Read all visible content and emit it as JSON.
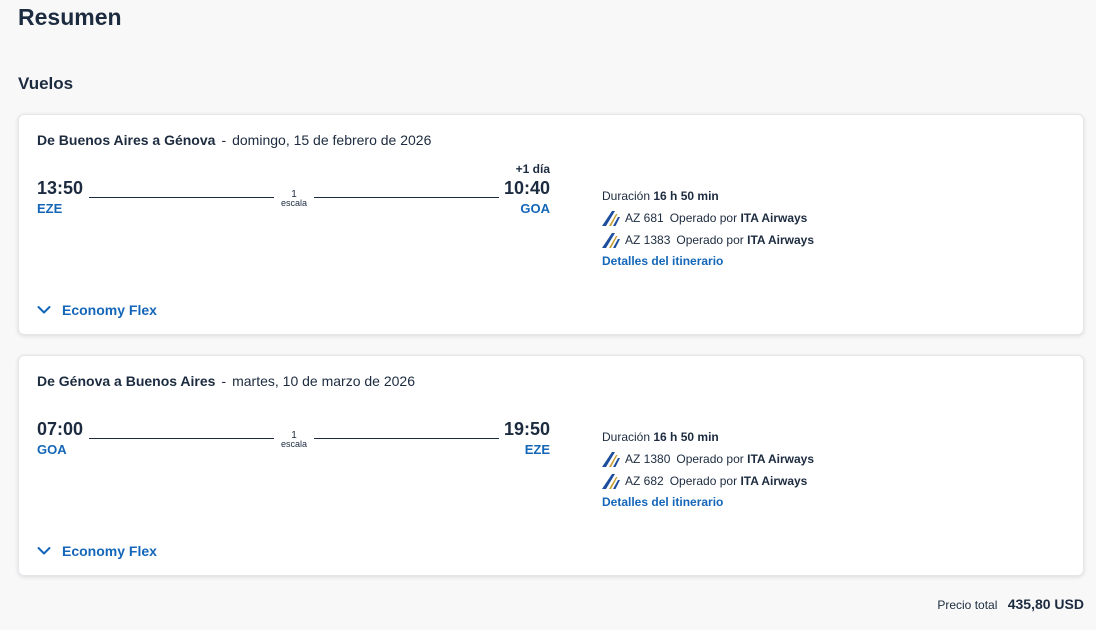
{
  "page": {
    "title": "Resumen",
    "section_title": "Vuelos"
  },
  "flights": [
    {
      "route": "De Buenos Aires a Génova",
      "separator": "-",
      "date": "domingo, 15 de febrero de 2026",
      "departure_time": "13:50",
      "departure_airport": "EZE",
      "arrival_time": "10:40",
      "arrival_airport": "GOA",
      "day_offset": "+1 día",
      "stops_count": "1",
      "stops_label": "escala",
      "duration_label": "Duración",
      "duration_value": "16 h 50 min",
      "segments": [
        {
          "flight_number": "AZ 681",
          "operated_by_label": "Operado por",
          "operator": "ITA Airways"
        },
        {
          "flight_number": "AZ 1383",
          "operated_by_label": "Operado por",
          "operator": "ITA Airways"
        }
      ],
      "itinerary_link": "Detalles del itinerario",
      "fare_name": "Economy Flex"
    },
    {
      "route": "De Génova a Buenos Aires",
      "separator": "-",
      "date": "martes, 10 de marzo de 2026",
      "departure_time": "07:00",
      "departure_airport": "GOA",
      "arrival_time": "19:50",
      "arrival_airport": "EZE",
      "stops_count": "1",
      "stops_label": "escala",
      "duration_label": "Duración",
      "duration_value": "16 h 50 min",
      "segments": [
        {
          "flight_number": "AZ 1380",
          "operated_by_label": "Operado por",
          "operator": "ITA Airways"
        },
        {
          "flight_number": "AZ 682",
          "operated_by_label": "Operado por",
          "operator": "ITA Airways"
        }
      ],
      "itinerary_link": "Detalles del itinerario",
      "fare_name": "Economy Flex"
    }
  ],
  "total": {
    "label": "Precio total",
    "amount": "435,80 USD"
  },
  "icons": {
    "airline": "ita-airways-logo-icon",
    "expand": "chevron-down-icon"
  },
  "colors": {
    "link": "#1466b8",
    "text": "#1c2b3f",
    "logo_blue": "#1d4e9e",
    "logo_gold": "#c6a02f"
  }
}
